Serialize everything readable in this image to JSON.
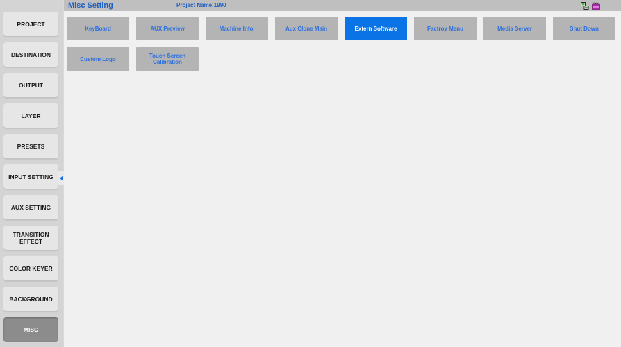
{
  "header": {
    "page_title": "Misc Setting",
    "project_label": "Project Name:1990"
  },
  "sidebar": {
    "items": [
      {
        "label": "PROJECT"
      },
      {
        "label": "DESTINATION"
      },
      {
        "label": "OUTPUT"
      },
      {
        "label": "LAYER"
      },
      {
        "label": "PRESETS"
      },
      {
        "label": "INPUT SETTING"
      },
      {
        "label": "AUX SETTING"
      },
      {
        "label": "TRANSITION EFFECT"
      },
      {
        "label": "COLOR KEYER"
      },
      {
        "label": "BACKGROUND"
      },
      {
        "label": "MISC",
        "active": true
      }
    ]
  },
  "misc": {
    "tiles": [
      {
        "label": "KeyBoard"
      },
      {
        "label": "AUX Preview"
      },
      {
        "label": "Machine Info."
      },
      {
        "label": "Aux Clone Main"
      },
      {
        "label": "Extern Software",
        "active": true
      },
      {
        "label": "Factroy Menu"
      },
      {
        "label": "Media Server"
      },
      {
        "label": "Shut Down"
      },
      {
        "label": "Custom Logo"
      },
      {
        "label": "Touch Screen Calibration"
      }
    ]
  },
  "icons": {
    "network": "network-status-icon",
    "media": "media-status-icon"
  },
  "colors": {
    "accent": "#0a73e6",
    "title_text": "#1f5fbf",
    "tile_bg": "#b4b4b4",
    "tile_text": "#2b6fe0",
    "active_sidebar": "#8c8c8c"
  }
}
